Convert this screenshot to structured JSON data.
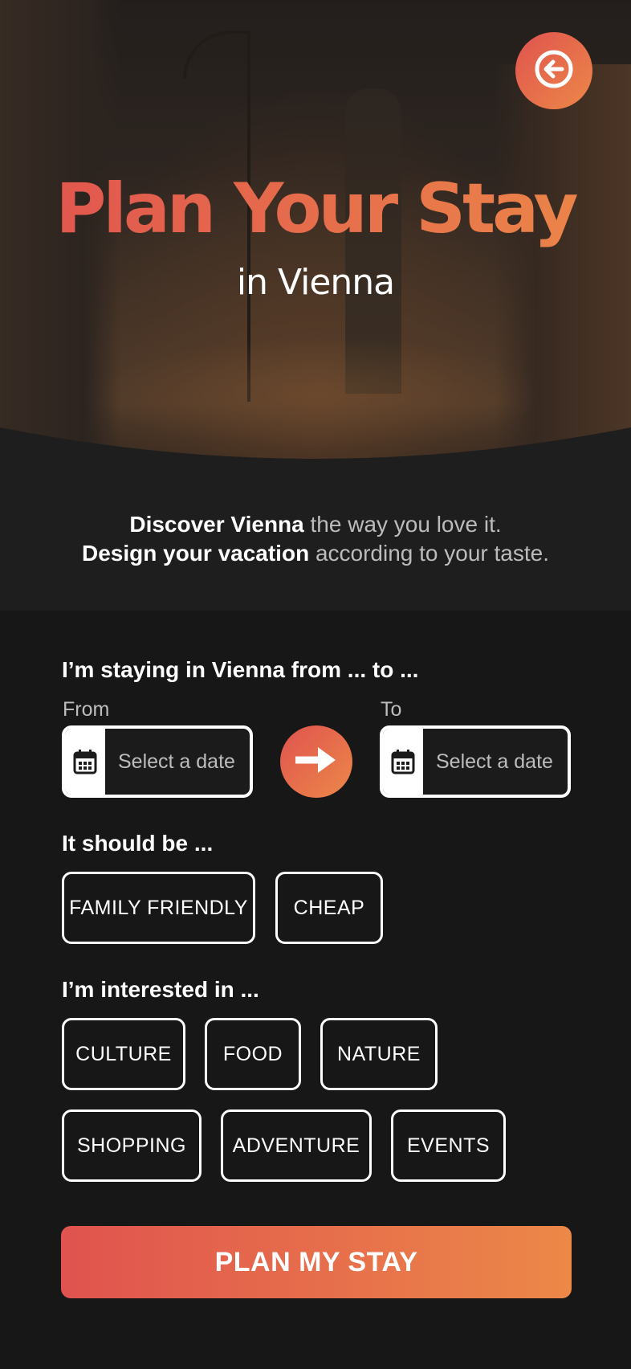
{
  "hero": {
    "title": "Plan Your Stay",
    "subtitle": "in Vienna",
    "back_icon": "arrow-left-circle-icon"
  },
  "intro": {
    "line1_bold": "Discover Vienna",
    "line1_rest": " the way you love it.",
    "line2_bold": "Design your vacation",
    "line2_rest": " according to your taste."
  },
  "dates": {
    "question": "I’m staying in Vienna from ... to ...",
    "from_label": "From",
    "to_label": "To",
    "from_placeholder": "Select a date",
    "to_placeholder": "Select a date",
    "calendar_icon": "calendar-icon",
    "arrow_icon": "arrow-right-icon"
  },
  "should_be": {
    "question": "It should be ...",
    "options": [
      "FAMILY FRIENDLY",
      "CHEAP"
    ]
  },
  "interests": {
    "question": "I’m interested in ...",
    "options": [
      "CULTURE",
      "FOOD",
      "NATURE",
      "SHOPPING",
      "ADVENTURE",
      "EVENTS"
    ]
  },
  "cta": {
    "label": "PLAN MY STAY"
  },
  "colors": {
    "accent_start": "#e0534f",
    "accent_end": "#ec8848",
    "background": "#171717"
  }
}
